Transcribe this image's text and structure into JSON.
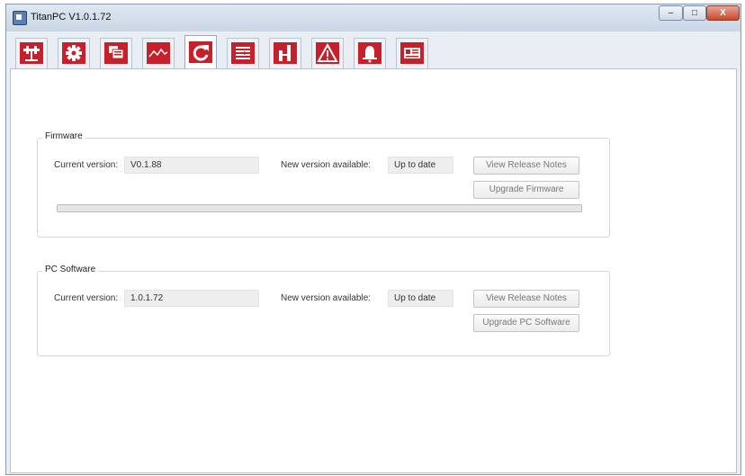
{
  "window": {
    "title": "TitanPC V1.0.1.72",
    "controls": {
      "minimize": "–",
      "maximize": "□",
      "close": "X"
    }
  },
  "toolbar": {
    "tabs": [
      {
        "icon": "usb-connection-icon",
        "active": false
      },
      {
        "icon": "gear-icon",
        "active": false
      },
      {
        "icon": "display-config-icon",
        "active": false
      },
      {
        "icon": "waveform-icon",
        "active": false
      },
      {
        "icon": "refresh-update-icon",
        "active": true
      },
      {
        "icon": "list-transfer-icon",
        "active": false
      },
      {
        "icon": "bar-level-icon",
        "active": false
      },
      {
        "icon": "warning-triangle-icon",
        "active": false
      },
      {
        "icon": "bell-alarm-icon",
        "active": false
      },
      {
        "icon": "id-card-icon",
        "active": false
      }
    ],
    "tile_color": "#c8202a"
  },
  "firmware": {
    "group_title": "Firmware",
    "current_label": "Current version:",
    "current_value": "V0.1.88",
    "new_label": "New version available:",
    "new_value": "Up to date",
    "release_notes_button": "View Release Notes",
    "upgrade_button": "Upgrade Firmware",
    "progress": 0
  },
  "pc_software": {
    "group_title": "PC Software",
    "current_label": "Current version:",
    "current_value": "1.0.1.72",
    "new_label": "New version available:",
    "new_value": "Up to date",
    "release_notes_button": "View Release Notes",
    "upgrade_button": "Upgrade PC Software"
  }
}
